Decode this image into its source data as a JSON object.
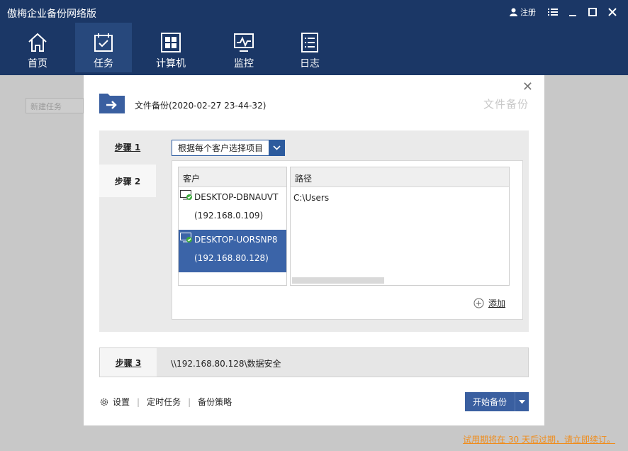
{
  "app": {
    "title": "傲梅企业备份网络版",
    "register_label": "注册"
  },
  "nav": {
    "home": "首页",
    "tasks": "任务",
    "computers": "计算机",
    "monitor": "监控",
    "logs": "日志"
  },
  "background": {
    "new_task_placeholder": "新建任务"
  },
  "dialog": {
    "title": "文件备份(2020-02-27 23-44-32)",
    "watermark": "文件备份",
    "steps": {
      "step1": "步骤 1",
      "step2": "步骤 2",
      "step3": "步骤 3"
    },
    "select_value": "根据每个客户选择项目",
    "client_header": "客户",
    "path_header": "路径",
    "clients": [
      {
        "name": "DESKTOP-DBNAUVT",
        "ip": "(192.168.0.109)"
      },
      {
        "name": "DESKTOP-UORSNP8",
        "ip": "(192.168.80.128)"
      }
    ],
    "path_value": "C:\\Users",
    "add_label": "添加",
    "step3_path": "\\\\192.168.80.128\\数据安全",
    "footer": {
      "settings": "设置",
      "schedule": "定时任务",
      "strategy": "备份策略"
    },
    "start_label": "开始备份"
  },
  "trial_notice": "试用期将在 30 天后过期，请立即续订。",
  "colors": {
    "titlebar": "#1b3766",
    "nav_active": "#27487c",
    "selection": "#3b64a8",
    "button": "#3a5fa0",
    "trial_text": "#f08c1a"
  }
}
